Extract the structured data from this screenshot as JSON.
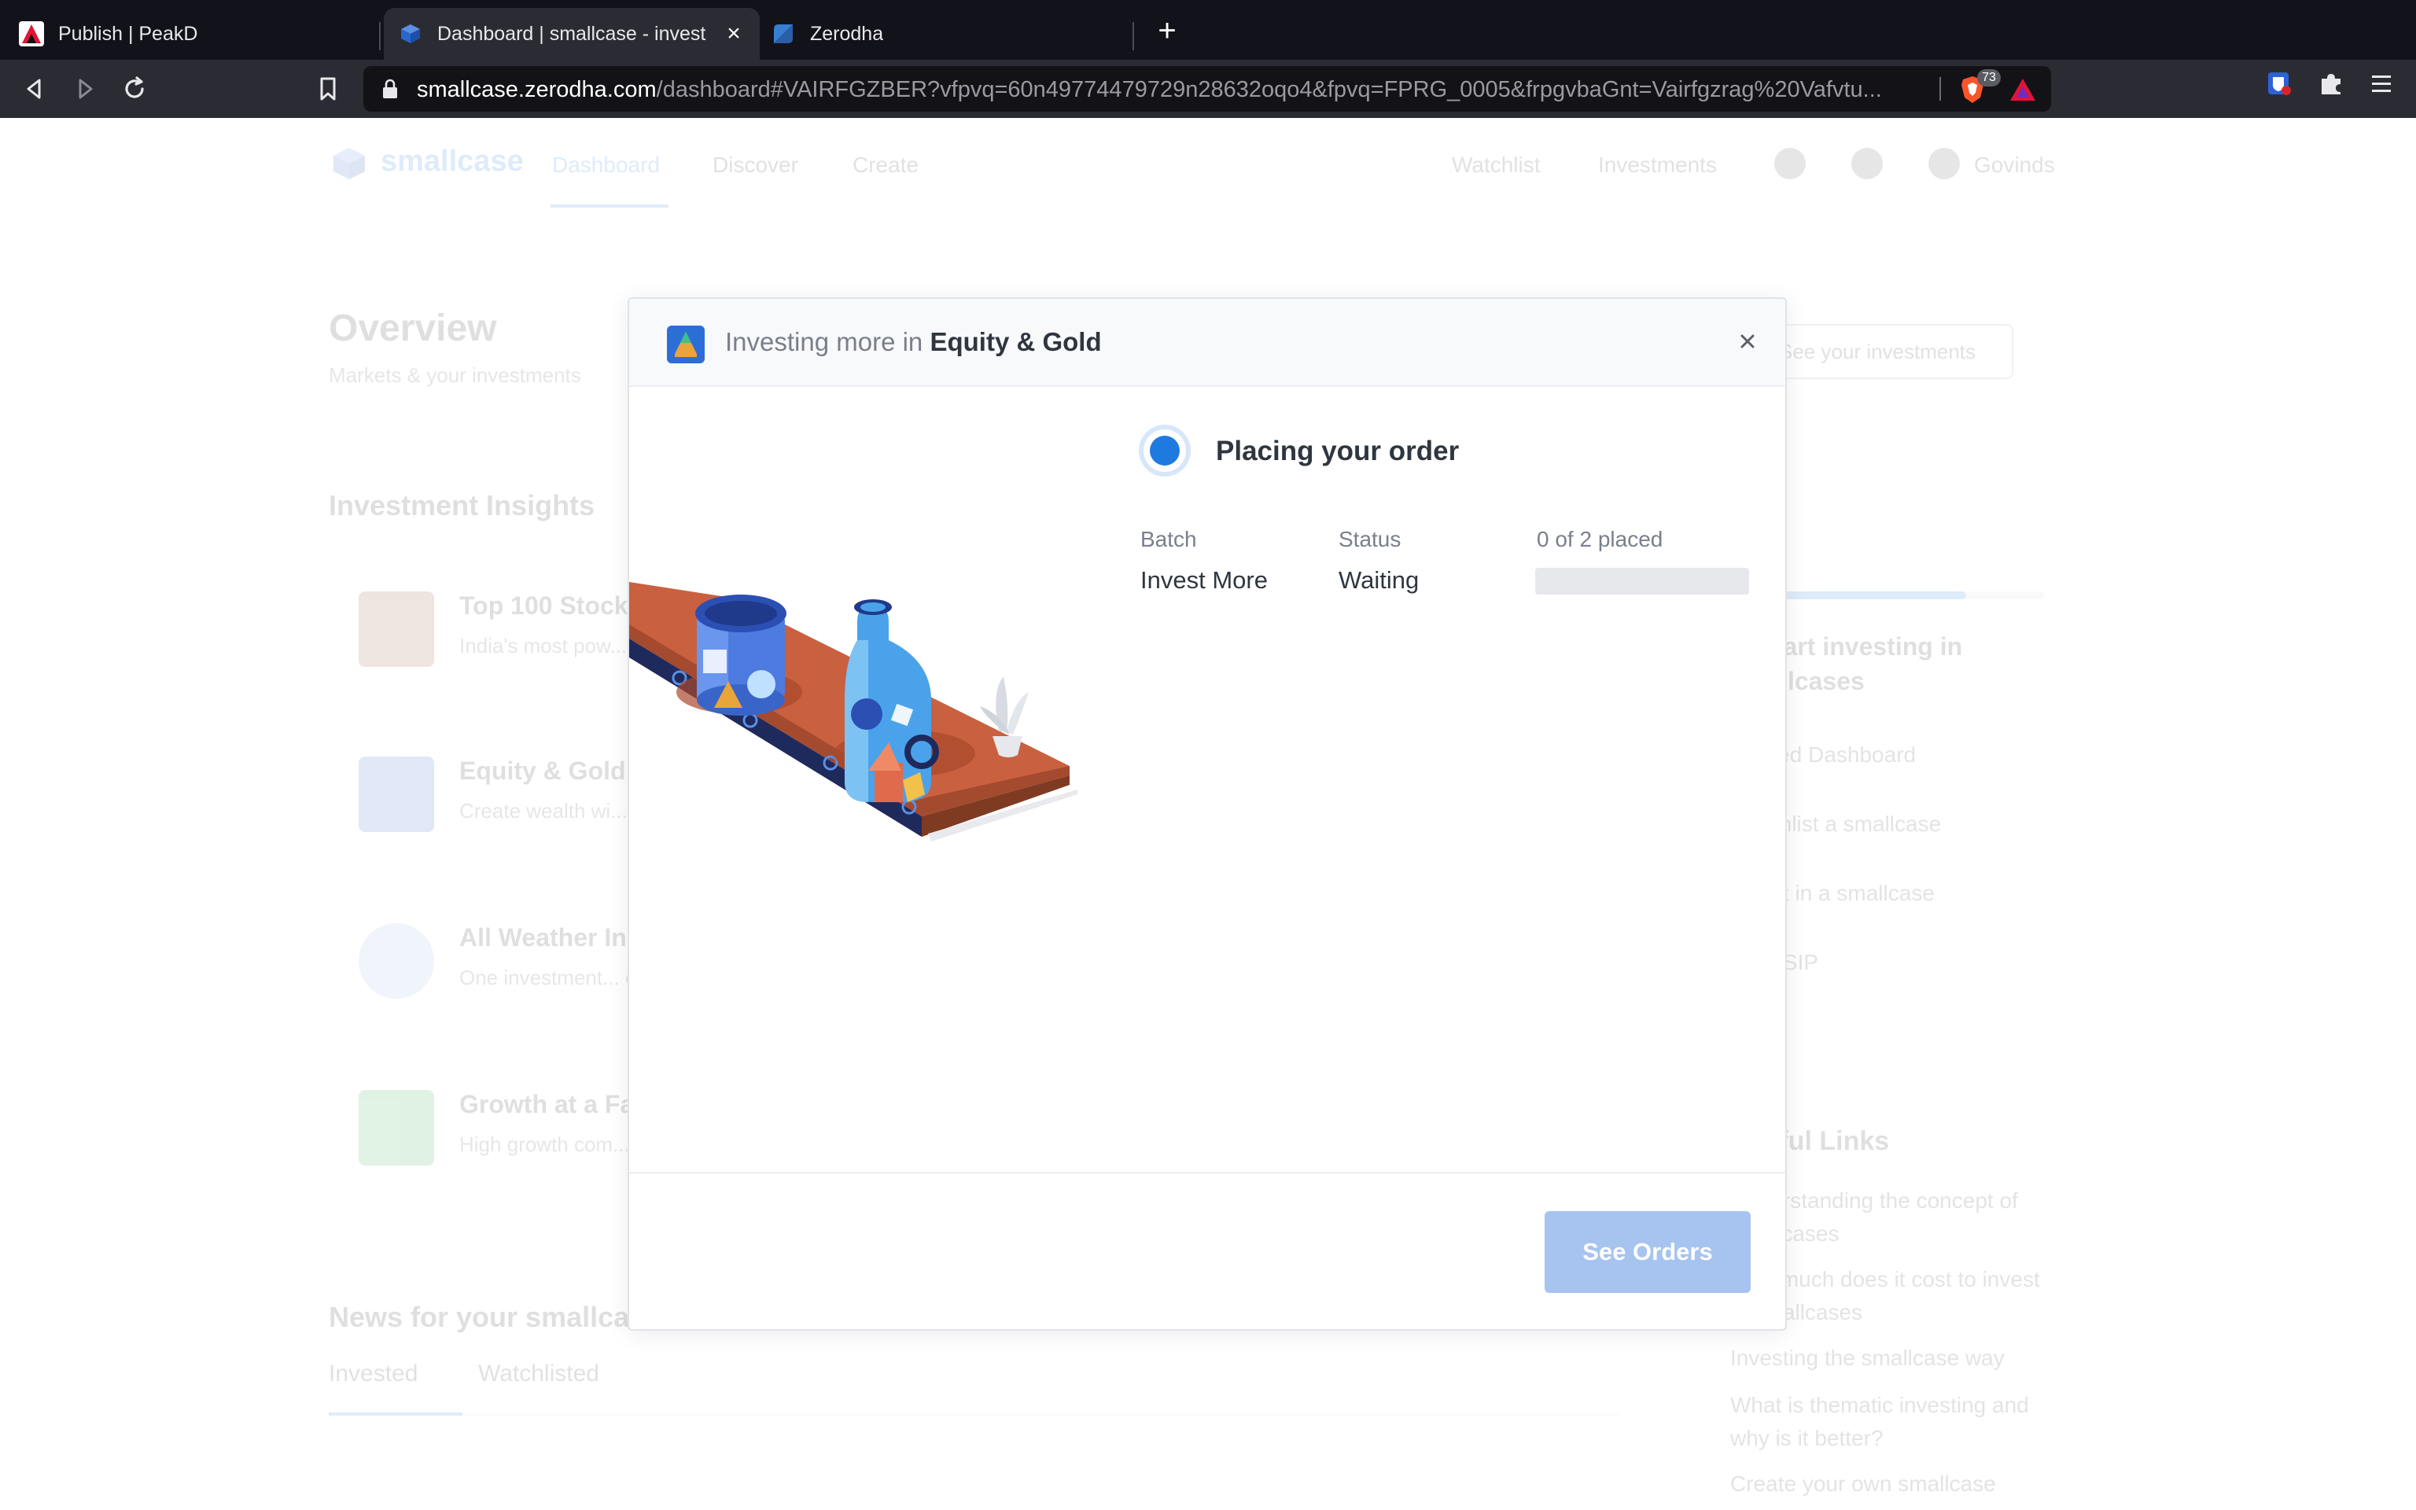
{
  "browser": {
    "tabs": [
      {
        "title": "Publish | PeakD",
        "active": false
      },
      {
        "title": "Dashboard | smallcase - invest",
        "active": true
      },
      {
        "title": "Zerodha",
        "active": false
      }
    ],
    "url": {
      "host": "smallcase.zerodha.com",
      "path": "/dashboard#VAIRFGZBER?vfpvq=60n49774479729n28632oqo4&fpvq=FPRG_0005&frpgvbaGnt=Vairfgzrag%20Vafvtu..."
    },
    "brave_shield_count": "73"
  },
  "background_page": {
    "nav": {
      "brand": "smallcase",
      "links": [
        "Dashboard",
        "Discover",
        "Create"
      ],
      "right_links": [
        "Watchlist",
        "Investments"
      ],
      "user": "Govinds"
    },
    "overview": {
      "title": "Overview",
      "subtitle": "Markets & your investments"
    },
    "insights": {
      "title": "Investment Insights",
      "items": [
        {
          "name": "Top 100 Stock",
          "desc": "India's most pow... one portfolio. Sc..."
        },
        {
          "name": "Equity & Gold",
          "desc": "Create wealth wi... protected with G..."
        },
        {
          "name": "All Weather In",
          "desc": "One investment... conditions. Work..."
        },
        {
          "name": "Growth at a Fa",
          "desc": "High growth com... available at fair..."
        }
      ]
    },
    "news": {
      "title": "News for your smallca",
      "tabs": [
        "Invested",
        "Watchlisted"
      ]
    },
    "sidebar": {
      "button": "See your investments",
      "heading": "to start investing in smallcases",
      "steps": [
        "Viewed Dashboard",
        "Watchlist a smallcase",
        "Invest in a smallcase",
        "Start SIP"
      ],
      "links_heading": "Useful Links",
      "links": [
        "Understanding the concept of smallcases",
        "How much does it cost to invest in smallcases",
        "Investing the smallcase way",
        "What is thematic investing and why is it better?",
        "Create your own smallcase"
      ]
    }
  },
  "modal": {
    "title_prefix": "Investing more in",
    "title_name": "Equity & Gold",
    "status_heading": "Placing your order",
    "columns": {
      "batch_label": "Batch",
      "batch_value": "Invest More",
      "status_label": "Status",
      "status_value": "Waiting",
      "placed_label": "0 of 2 placed"
    },
    "progress_fraction": 0,
    "see_orders_label": "See Orders",
    "colors": {
      "accent": "#1f7ae0",
      "button_disabled": "#a6c4ef",
      "progress_track": "#e6e8ec"
    }
  }
}
